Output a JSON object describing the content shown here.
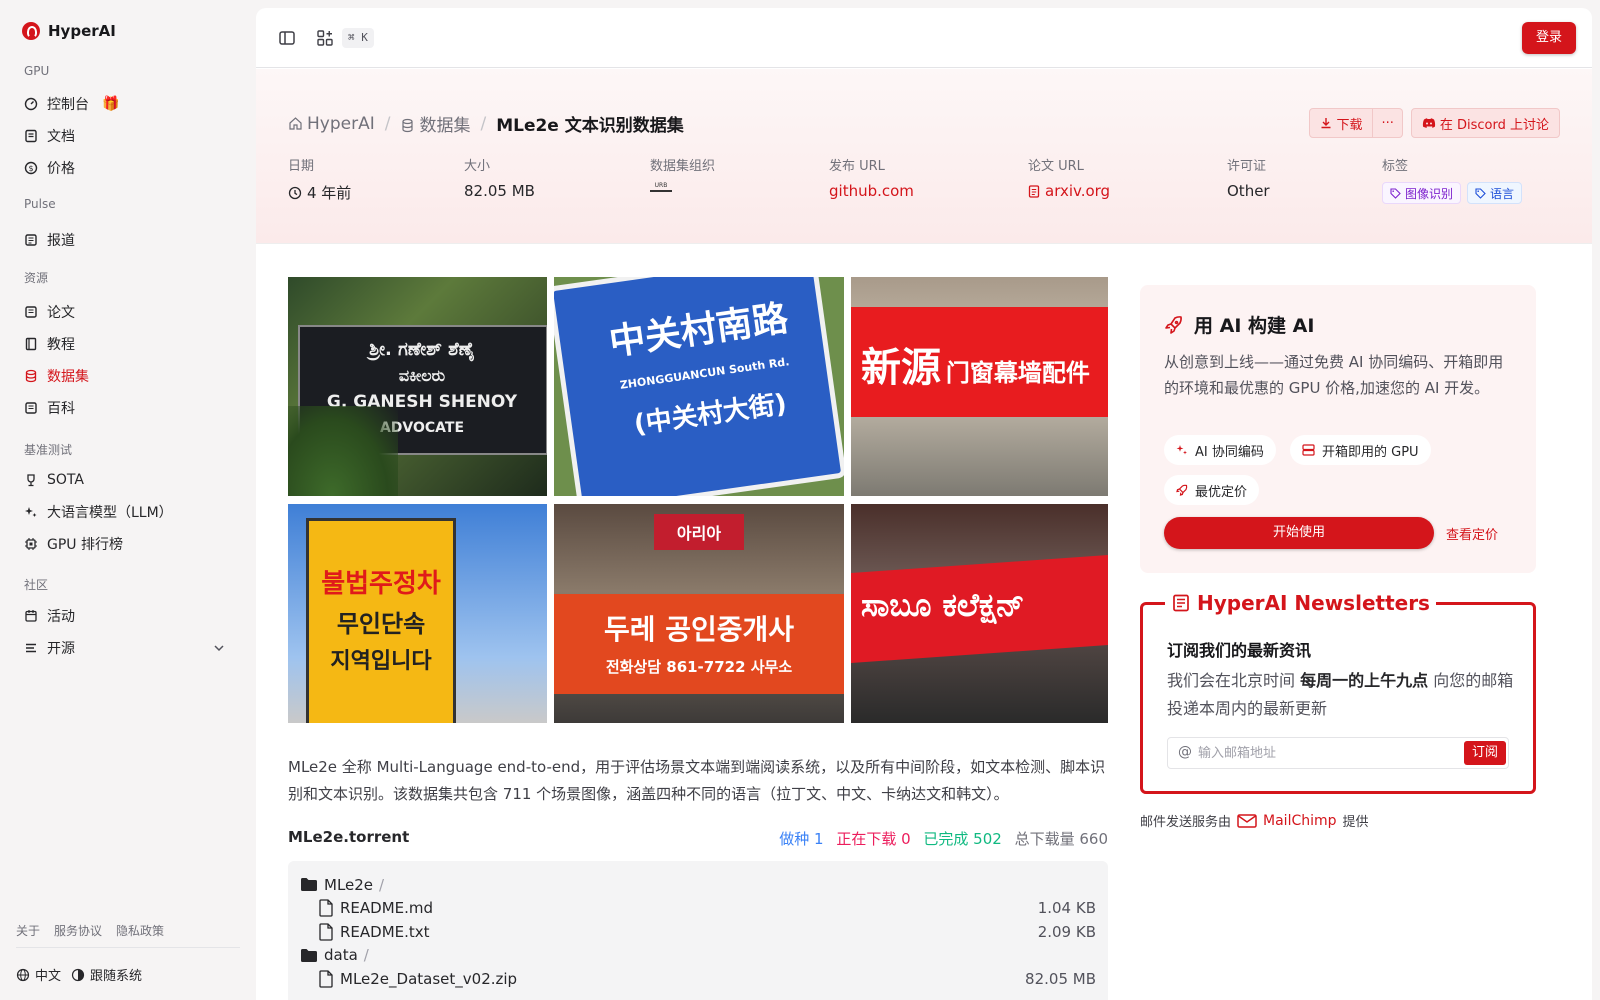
{
  "app": {
    "brand": "HyperAI"
  },
  "sidebar": {
    "sections": [
      {
        "title": "GPU",
        "items": [
          {
            "label": "控制台",
            "icon": "dashboard-icon",
            "badge": "gift-icon"
          },
          {
            "label": "文档",
            "icon": "document-icon"
          },
          {
            "label": "价格",
            "icon": "dollar-icon"
          }
        ]
      },
      {
        "title": "Pulse",
        "items": [
          {
            "label": "报道",
            "icon": "newspaper-icon"
          }
        ]
      },
      {
        "title": "资源",
        "items": [
          {
            "label": "论文",
            "icon": "paper-icon"
          },
          {
            "label": "教程",
            "icon": "book-icon"
          },
          {
            "label": "数据集",
            "icon": "database-icon",
            "active": true
          },
          {
            "label": "百科",
            "icon": "encyclopedia-icon"
          }
        ]
      },
      {
        "title": "基准测试",
        "items": [
          {
            "label": "SOTA",
            "icon": "trophy-icon"
          },
          {
            "label": "大语言模型（LLM）",
            "icon": "sparkles-icon"
          },
          {
            "label": "GPU 排行榜",
            "icon": "chip-icon"
          }
        ]
      },
      {
        "title": "社区",
        "items": [
          {
            "label": "活动",
            "icon": "calendar-icon"
          },
          {
            "label": "开源",
            "icon": "list-icon"
          }
        ]
      }
    ],
    "footer_links": [
      "关于",
      "服务协议",
      "隐私政策"
    ],
    "language": "中文",
    "theme": "跟随系统"
  },
  "topbar": {
    "shortcut": "⌘ K",
    "login_label": "登录"
  },
  "breadcrumb": {
    "home": "HyperAI",
    "section": "数据集",
    "current": "MLe2e 文本识别数据集"
  },
  "actions": {
    "download": "下载",
    "more": "···",
    "discord": "在 Discord 上讨论"
  },
  "meta": {
    "date_label": "日期",
    "date_value": "4 年前",
    "size_label": "大小",
    "size_value": "82.05 MB",
    "org_label": "数据集组织",
    "org_logo_text": "URB",
    "release_label": "发布 URL",
    "release_value": "github.com",
    "paper_label": "论文 URL",
    "paper_value": "arxiv.org",
    "license_label": "许可证",
    "license_value": "Other",
    "tags_label": "标签",
    "tags": [
      "图像识别",
      "语言"
    ]
  },
  "images": {
    "signs": [
      {
        "line1": "ಶ್ರೀ. ಗಣೇಶ್ ಶೆಣೈ",
        "line2": "ವಕೀಲರು",
        "line3": "G. GANESH SHENOY",
        "line4": "ADVOCATE"
      },
      {
        "line1": "中关村南路",
        "line2": "ZHONGGUANCUN South Rd.",
        "line3": "(中关村大街)"
      },
      {
        "line1": "新源",
        "line2": "门窗幕墙配件"
      },
      {
        "line1": "불법주정차",
        "line2": "무인단속",
        "line3": "지역입니다"
      },
      {
        "line1": "아리아",
        "line2": "두레  공인중개사",
        "line3": "전화상담 861-7722 사무소"
      },
      {
        "line1": "ಸಾಬೂ ಕಲೆಕ್ಷನ್"
      }
    ]
  },
  "description": "MLe2e 全称 Multi-Language end-to-end，用于评估场景文本端到端阅读系统，以及所有中间阶段，如文本检测、脚本识别和文本识别。该数据集共包含 711 个场景图像，涵盖四种不同的语言（拉丁文、中文、卡纳达文和韩文）。",
  "torrent": {
    "name": "MLe2e.torrent",
    "seeding": "做种 1",
    "downloading": "正在下载 0",
    "completed": "已完成 502",
    "total": "总下载量 660",
    "files": [
      {
        "type": "folder",
        "name": "MLe2e",
        "slash": "/"
      },
      {
        "type": "file",
        "name": "README.md",
        "size": "1.04 KB"
      },
      {
        "type": "file",
        "name": "README.txt",
        "size": "2.09 KB"
      },
      {
        "type": "folder",
        "name": "data",
        "slash": "/"
      },
      {
        "type": "file",
        "name": "MLe2e_Dataset_v02.zip",
        "size": "82.05 MB"
      }
    ]
  },
  "promo": {
    "title": "用 AI 构建 AI",
    "body": "从创意到上线——通过免费 AI 协同编码、开箱即用的环境和最优惠的 GPU 价格,加速您的 AI 开发。",
    "chips": [
      "AI 协同编码",
      "开箱即用的 GPU",
      "最优定价"
    ],
    "start": "开始使用",
    "pricing": "查看定价"
  },
  "newsletter": {
    "legend": "HyperAI Newsletters",
    "heading": "订阅我们的最新资讯",
    "body_pre": "我们会在北京时间 ",
    "body_bold": "每周一的上午九点",
    "body_post": " 向您的邮箱投递本周内的最新更新",
    "placeholder": "输入邮箱地址",
    "subscribe": "订阅"
  },
  "mailchimp": {
    "pre": "邮件发送服务由",
    "brand": "MailChimp",
    "post": "提供"
  },
  "colors": {
    "accent": "#d4151b",
    "seed": "#3b82f6",
    "downloading": "#ec1d5c",
    "done": "#10b981"
  }
}
